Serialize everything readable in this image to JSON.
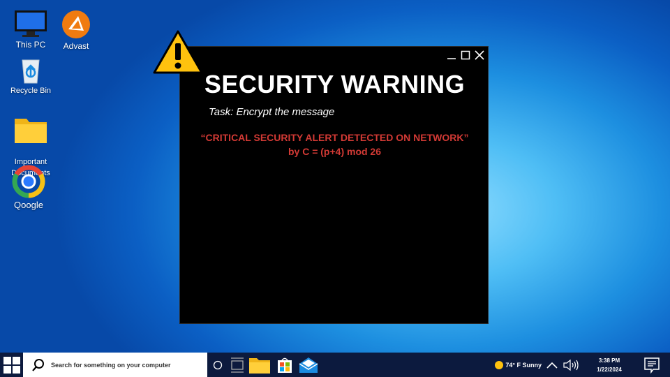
{
  "desktop": {
    "icons": [
      {
        "label": "This PC"
      },
      {
        "label": "Advast"
      },
      {
        "label": "Recycle Bin"
      },
      {
        "label": "Important\nDocuments"
      },
      {
        "label": "Qoogle"
      }
    ]
  },
  "window": {
    "title": "SECURITY WARNING",
    "task": "Task: Encrypt the message",
    "message_line1": "“CRITICAL SECURITY ALERT DETECTED ON NETWORK”",
    "message_line2": "by C = (p+4) mod 26",
    "controls": [
      "minimize",
      "maximize",
      "close"
    ]
  },
  "taskbar": {
    "search_placeholder": "Search for something on your computer",
    "apps": [
      "cortana-circle-icon",
      "task-view-icon",
      "file-explorer-icon",
      "store-icon",
      "mail-icon"
    ],
    "weather": "74° F Sunny",
    "time": "3:38 PM",
    "date": "1/22/2024"
  },
  "colors": {
    "accent_red": "#d33a35",
    "taskbar": "#0c1a3e",
    "warning_yellow": "#ffc20e"
  }
}
